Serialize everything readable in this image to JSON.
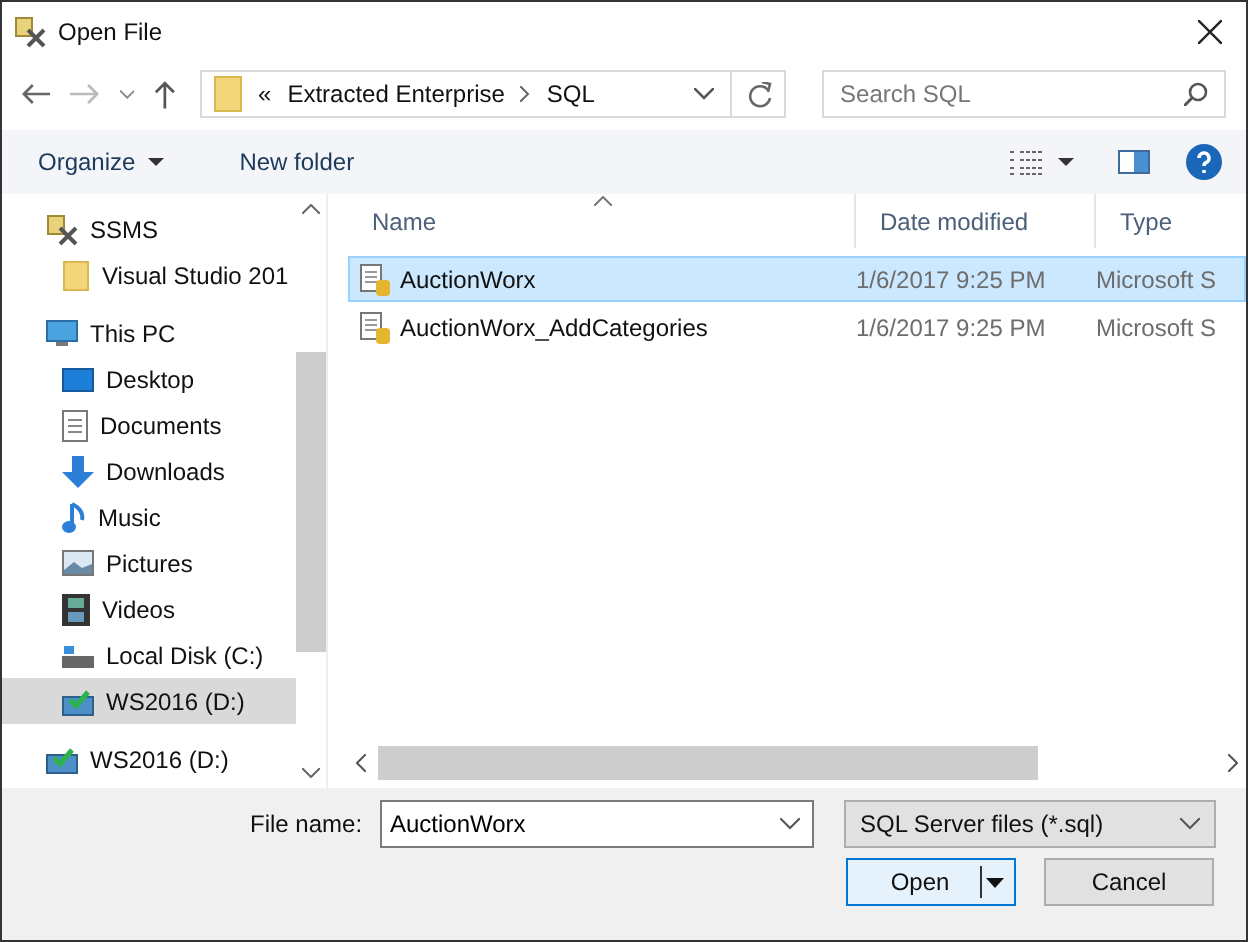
{
  "window": {
    "title": "Open File"
  },
  "address": {
    "overflow": "«",
    "crumbs": [
      "Extracted Enterprise",
      "SQL"
    ]
  },
  "search": {
    "placeholder": "Search SQL"
  },
  "toolbar": {
    "organize": "Organize",
    "new_folder": "New folder"
  },
  "sidebar": {
    "items": [
      {
        "label": "SSMS",
        "kind": "tools",
        "selected": false,
        "children": [
          {
            "label": "Visual Studio 201",
            "kind": "folder",
            "selected": false
          }
        ]
      },
      {
        "label": "This PC",
        "kind": "pc",
        "selected": false,
        "children": [
          {
            "label": "Desktop",
            "kind": "desktop",
            "selected": false
          },
          {
            "label": "Documents",
            "kind": "documents",
            "selected": false
          },
          {
            "label": "Downloads",
            "kind": "downloads",
            "selected": false
          },
          {
            "label": "Music",
            "kind": "music",
            "selected": false
          },
          {
            "label": "Pictures",
            "kind": "pictures",
            "selected": false
          },
          {
            "label": "Videos",
            "kind": "videos",
            "selected": false
          },
          {
            "label": "Local Disk (C:)",
            "kind": "disk",
            "selected": false
          },
          {
            "label": "WS2016 (D:)",
            "kind": "netdisk",
            "selected": true
          }
        ]
      },
      {
        "label": "WS2016 (D:)",
        "kind": "netdisk",
        "selected": false
      }
    ]
  },
  "file_list": {
    "columns": [
      {
        "label": "Name",
        "sorted": true
      },
      {
        "label": "Date modified",
        "sorted": false
      },
      {
        "label": "Type",
        "sorted": false
      }
    ],
    "rows": [
      {
        "name": "AuctionWorx",
        "date": "1/6/2017 9:25 PM",
        "type": "Microsoft S",
        "selected": true
      },
      {
        "name": "AuctionWorx_AddCategories",
        "date": "1/6/2017 9:25 PM",
        "type": "Microsoft S",
        "selected": false
      }
    ]
  },
  "footer": {
    "file_name_label": "File name:",
    "file_name": "AuctionWorx",
    "filter": "SQL Server files (*.sql)",
    "buttons": [
      {
        "label": "Open",
        "kind": "split"
      },
      {
        "label": "Cancel",
        "kind": "plain"
      }
    ]
  }
}
